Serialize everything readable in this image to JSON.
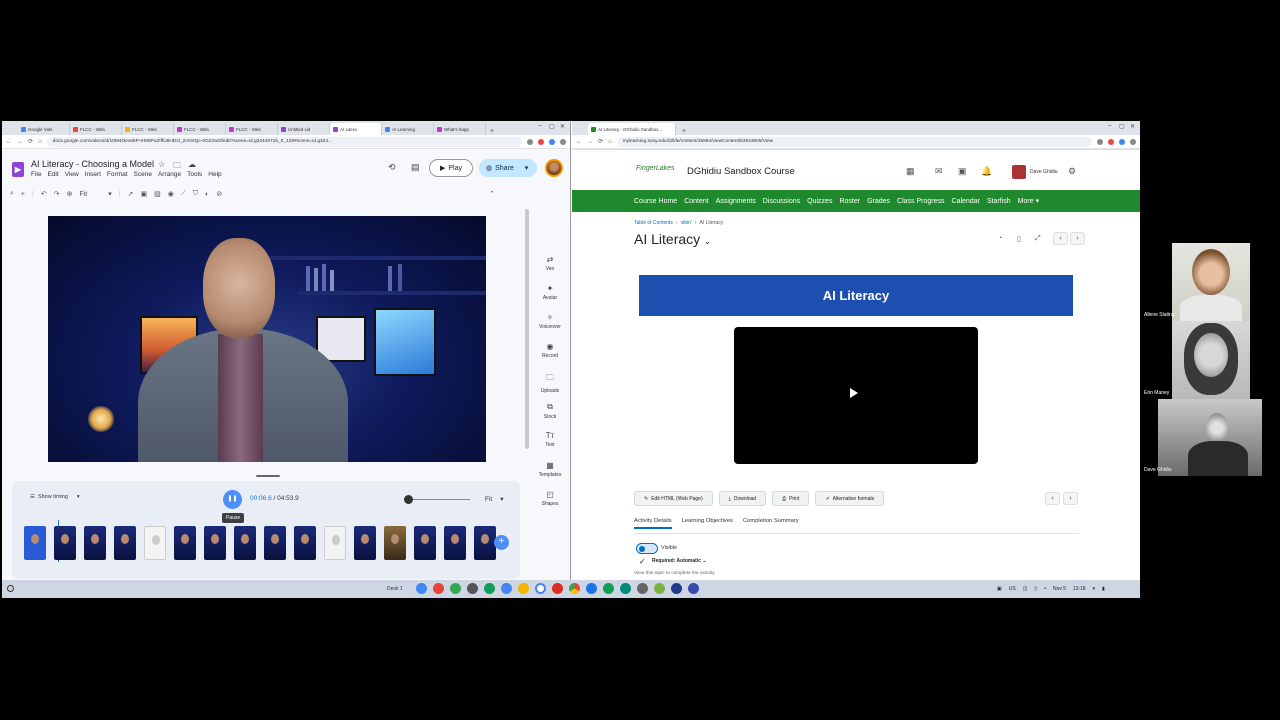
{
  "left_window": {
    "tabs": [
      "Google Vids",
      "FLCC - Web",
      "FLCC - Web",
      "FLCC - Web",
      "FLCC - Web",
      "Untitled vid",
      "AI Litera",
      "AI Learning",
      "What's happ"
    ],
    "url": "docs.google.com/videos/d/10M4Oev85P-IH95PuZIffU8HDzI_2mGrQc-0GZzaOl/edit?scene=id.g3244571b_0_129#scene=id.g324...",
    "doc_title": "AI Literacy - Choosing a Model",
    "menu": [
      "File",
      "Edit",
      "View",
      "Insert",
      "Format",
      "Scene",
      "Arrange",
      "Tools",
      "Help"
    ],
    "play_label": "Play",
    "share_label": "Share",
    "zoom_fit": "Fit",
    "side_panel": [
      "Veo",
      "Avatar",
      "Voiceover",
      "Record",
      "Uploads",
      "Stock",
      "Text",
      "Templates",
      "Shapes"
    ],
    "show_timing": "Show timing",
    "time_current": "00:06.6",
    "time_separator": " / ",
    "time_total": "04:53.9",
    "pause_tooltip": "Pause",
    "fit_label": "Fit",
    "colors": {
      "accent": "#4f8ef7",
      "vids_logo": "#8e44d6",
      "share_bg": "#c2e7ff"
    }
  },
  "right_window": {
    "tab_title": "AI Literacy - DGhidiu Sandbox ...",
    "url": "mylearning.suny.edu/d2l/le/content/15994/viewContent/53943605/View",
    "logo_text": "FingerLakes",
    "course_title": "DGhidiu Sandbox Course",
    "user_name": "Dave Ghidiu",
    "nav": [
      "Course Home",
      "Content",
      "Assignments",
      "Discussions",
      "Quizzes",
      "Roster",
      "Grades",
      "Class Progress",
      "Calendar",
      "Starfish",
      "More"
    ],
    "breadcrumb": [
      "Table of Contents",
      "vibin'",
      "AI Literacy"
    ],
    "page_title": "AI Literacy",
    "banner_text": "AI Literacy",
    "actions": [
      "Edit HTML (Web Page)",
      "Download",
      "Print",
      "Alternative formats"
    ],
    "sub_tabs": [
      "Activity Details",
      "Learning Objectives",
      "Completion Summary"
    ],
    "visible_label": "Visible",
    "required_label": "Required: Automatic",
    "hint_text": "View this topic to complete the activity",
    "colors": {
      "navbar": "#1e8a2d",
      "banner": "#1c4fb0",
      "link": "#006fbf"
    }
  },
  "shelf": {
    "desk_label": "Desk 1",
    "locale": "US",
    "date": "Nov 5",
    "time": "13:18"
  },
  "participants": [
    {
      "name": "Allene Slating"
    },
    {
      "name": "Erin Maney"
    },
    {
      "name": "Dave Ghidiu"
    }
  ]
}
